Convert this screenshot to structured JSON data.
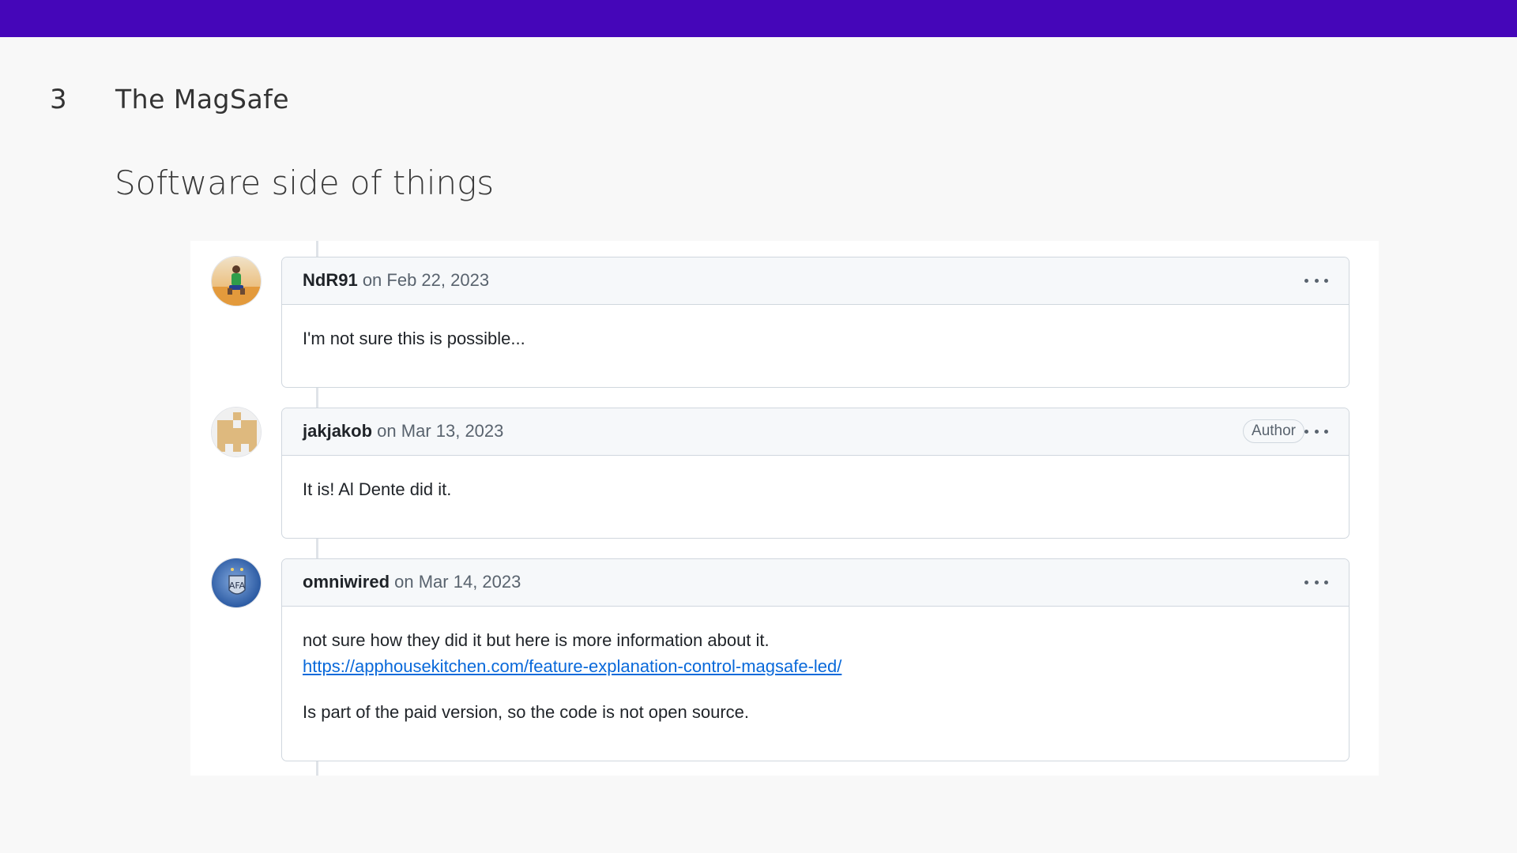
{
  "slide": {
    "number": "3",
    "title": "The MagSafe",
    "subtitle": "Software side of things"
  },
  "comments": [
    {
      "username": "NdR91",
      "date": "on Feb 22, 2023",
      "body": [
        "I'm not sure this is possible..."
      ]
    },
    {
      "username": "jakjakob",
      "date": "on Mar 13, 2023",
      "badge": "Author",
      "body": [
        "It is! Al Dente did it."
      ]
    },
    {
      "username": "omniwired",
      "date": "on Mar 14, 2023",
      "body": [
        "not sure how they did it but here is more information about it."
      ],
      "link": "https://apphousekitchen.com/feature-explanation-control-magsafe-led/",
      "body_extra": "Is part of the paid version, so the code is not open source."
    }
  ],
  "colors": {
    "top_bar": "#4506b9",
    "link": "#0969da"
  },
  "icons": {
    "more_options": "kebab-horizontal-icon"
  }
}
